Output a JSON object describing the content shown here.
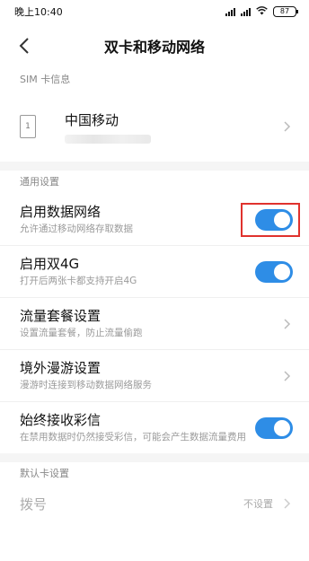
{
  "status_bar": {
    "time": "晚上10:40",
    "battery": "87"
  },
  "header": {
    "title": "双卡和移动网络"
  },
  "sim_section": {
    "label": "SIM 卡信息",
    "card_slot": "1",
    "carrier": "中国移动"
  },
  "general_section": {
    "label": "通用设置",
    "items": [
      {
        "title": "启用数据网络",
        "subtitle": "允许通过移动网络存取数据",
        "control": "toggle",
        "on": true
      },
      {
        "title": "启用双4G",
        "subtitle": "打开后两张卡都支持开启4G",
        "control": "toggle",
        "on": true
      },
      {
        "title": "流量套餐设置",
        "subtitle": "设置流量套餐，防止流量偷跑",
        "control": "chevron"
      },
      {
        "title": "境外漫游设置",
        "subtitle": "漫游时连接到移动数据网络服务",
        "control": "chevron"
      },
      {
        "title": "始终接收彩信",
        "subtitle": "在禁用数据时仍然接受彩信，可能会产生数据流量费用",
        "control": "toggle",
        "on": true
      }
    ]
  },
  "default_section": {
    "label": "默认卡设置",
    "dial_label": "拨号",
    "dial_value": "不设置"
  },
  "colors": {
    "toggle_on": "#2e8de6",
    "highlight": "#e0322d"
  }
}
